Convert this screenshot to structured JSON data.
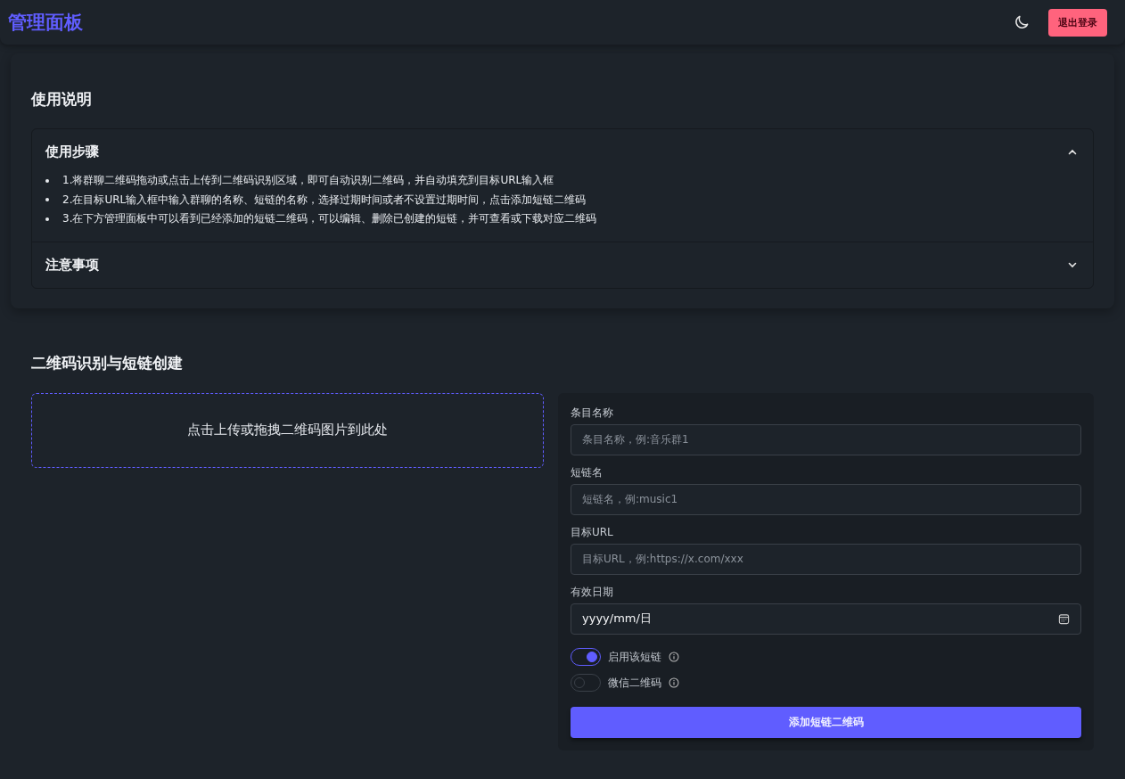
{
  "header": {
    "title": "管理面板",
    "logout": "退出登录"
  },
  "instructions": {
    "title": "使用说明",
    "sections": [
      {
        "title": "使用步骤",
        "expanded": true,
        "items": [
          "1.将群聊二维码拖动或点击上传到二维码识别区域，即可自动识别二维码，并自动填充到目标URL输入框",
          "2.在目标URL输入框中输入群聊的名称、短链的名称，选择过期时间或者不设置过期时间，点击添加短链二维码",
          "3.在下方管理面板中可以看到已经添加的短链二维码，可以编辑、删除已创建的短链，并可查看或下载对应二维码"
        ]
      },
      {
        "title": "注意事项",
        "expanded": false
      }
    ]
  },
  "create": {
    "title": "二维码识别与短链创建",
    "upload_hint": "点击上传或拖拽二维码图片到此处",
    "fields": [
      {
        "label": "条目名称",
        "placeholder": "条目名称，例:音乐群1"
      },
      {
        "label": "短链名",
        "placeholder": "短链名，例:music1"
      },
      {
        "label": "目标URL",
        "placeholder": "目标URL，例:https://x.com/xxx"
      },
      {
        "label": "有效日期",
        "value": "yyyy/mm/日",
        "kind": "date"
      }
    ],
    "toggles": [
      {
        "label": "启用该短链",
        "on": true
      },
      {
        "label": "微信二维码",
        "on": false
      }
    ],
    "submit": "添加短链二维码"
  }
}
